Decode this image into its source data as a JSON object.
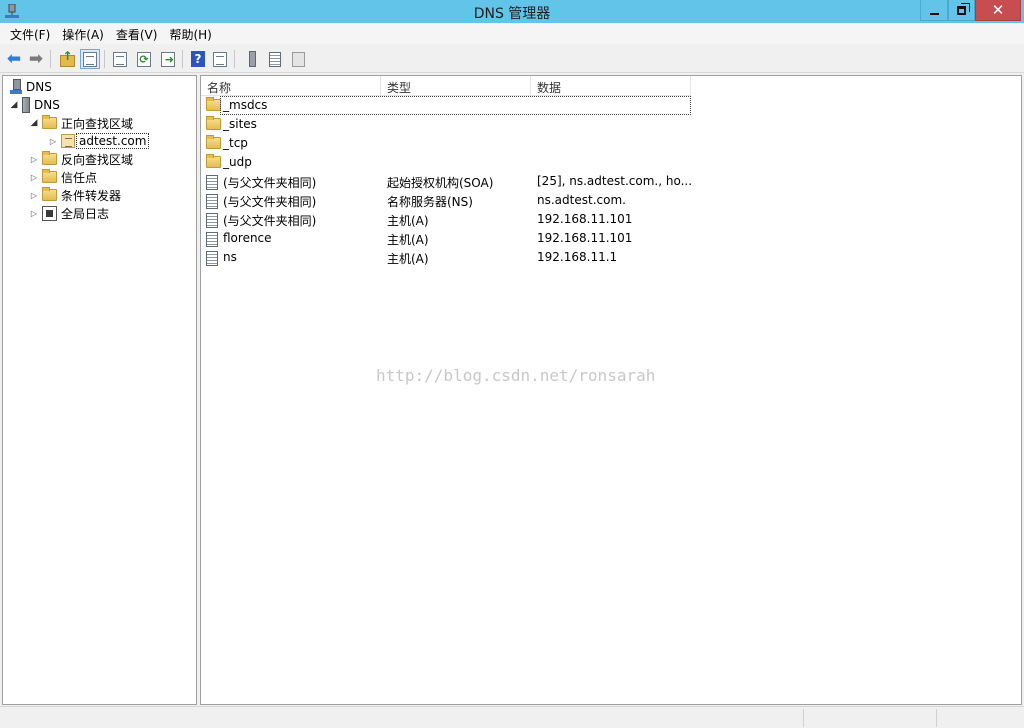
{
  "window": {
    "title": "DNS 管理器"
  },
  "menu": {
    "items": [
      "文件(F)",
      "操作(A)",
      "查看(V)",
      "帮助(H)"
    ]
  },
  "toolbar": {
    "icons": [
      "back-arrow-icon",
      "forward-arrow-icon",
      "up-folder-icon",
      "show-tree-icon",
      "properties-icon",
      "refresh-icon",
      "export-list-icon",
      "help-icon",
      "console-icon",
      "server-icon",
      "record-icon",
      "zone-record-icon"
    ],
    "help_glyph": "?"
  },
  "tree": {
    "items": [
      {
        "label": "DNS",
        "level": 0,
        "expander": "",
        "icon": "dns-root-icon"
      },
      {
        "label": "DNS",
        "level": 1,
        "expander": "open",
        "icon": "server-icon"
      },
      {
        "label": "正向查找区域",
        "level": 2,
        "expander": "open",
        "icon": "folder-icon"
      },
      {
        "label": "adtest.com",
        "level": 3,
        "expander": "closed",
        "icon": "zone-icon",
        "selected": true
      },
      {
        "label": "反向查找区域",
        "level": 2,
        "expander": "closed",
        "icon": "folder-icon"
      },
      {
        "label": "信任点",
        "level": 2,
        "expander": "closed",
        "icon": "folder-icon"
      },
      {
        "label": "条件转发器",
        "level": 2,
        "expander": "closed",
        "icon": "folder-icon"
      },
      {
        "label": "全局日志",
        "level": 2,
        "expander": "closed",
        "icon": "log-icon"
      }
    ]
  },
  "list": {
    "columns": [
      "名称",
      "类型",
      "数据"
    ],
    "rows": [
      {
        "name": "_msdcs",
        "type": "",
        "data": "",
        "icon": "folder-icon"
      },
      {
        "name": "_sites",
        "type": "",
        "data": "",
        "icon": "folder-icon"
      },
      {
        "name": "_tcp",
        "type": "",
        "data": "",
        "icon": "folder-icon"
      },
      {
        "name": "_udp",
        "type": "",
        "data": "",
        "icon": "folder-icon"
      },
      {
        "name": "(与父文件夹相同)",
        "type": "起始授权机构(SOA)",
        "data": "[25], ns.adtest.com., ho...",
        "icon": "record-icon"
      },
      {
        "name": "(与父文件夹相同)",
        "type": "名称服务器(NS)",
        "data": "ns.adtest.com.",
        "icon": "record-icon"
      },
      {
        "name": "(与父文件夹相同)",
        "type": "主机(A)",
        "data": "192.168.11.101",
        "icon": "record-icon"
      },
      {
        "name": "florence",
        "type": "主机(A)",
        "data": "192.168.11.101",
        "icon": "record-icon"
      },
      {
        "name": "ns",
        "type": "主机(A)",
        "data": "192.168.11.1",
        "icon": "record-icon"
      }
    ]
  },
  "watermark": "http://blog.csdn.net/ronsarah",
  "colors": {
    "titlebar": "#62c4e8",
    "close_button": "#c74d50",
    "back_arrow": "#2d7ed6"
  }
}
